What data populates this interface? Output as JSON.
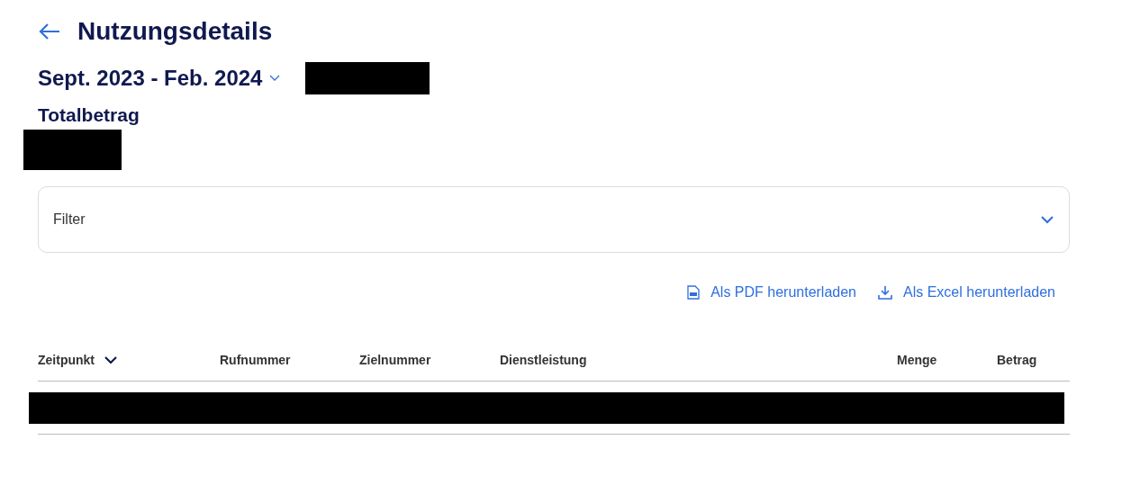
{
  "header": {
    "title": "Nutzungsdetails"
  },
  "period": {
    "label": "Sept. 2023 - Feb. 2024",
    "expanded": false
  },
  "total": {
    "label": "Totalbetrag"
  },
  "filter": {
    "label": "Filter",
    "expanded": false
  },
  "downloads": [
    {
      "kind": "pdf",
      "label": "Als PDF herunterladen"
    },
    {
      "kind": "excel",
      "label": "Als Excel herunterladen"
    }
  ],
  "table": {
    "columns": [
      {
        "label": "Zeitpunkt",
        "sorted": true
      },
      {
        "label": "Rufnummer",
        "sorted": false
      },
      {
        "label": "Zielnummer",
        "sorted": false
      },
      {
        "label": "Dienstleistung",
        "sorted": false
      },
      {
        "label": "Menge",
        "sorted": false
      },
      {
        "label": "Betrag",
        "sorted": false
      }
    ]
  }
}
